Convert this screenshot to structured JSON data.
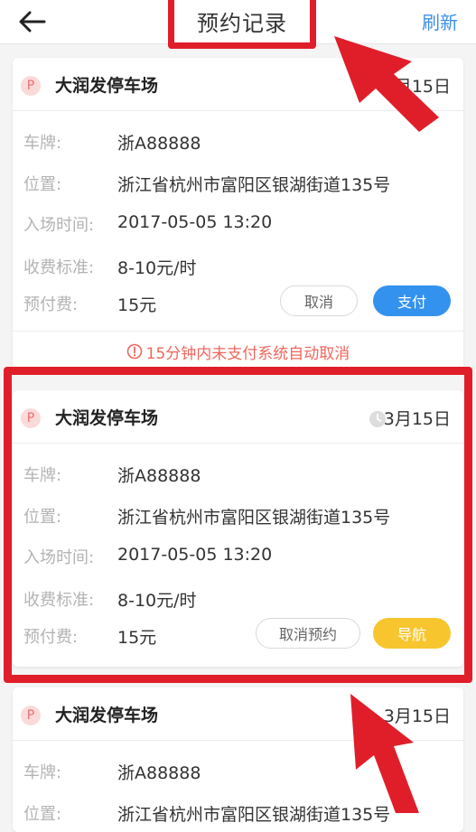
{
  "header": {
    "title": "预约记录",
    "refresh_label": "刷新"
  },
  "labels": {
    "plate": "车牌:",
    "location": "位置:",
    "entry_time": "入场时间:",
    "fee_standard": "收费标准:",
    "prepaid": "预付费:"
  },
  "cards": [
    {
      "badge": "P",
      "lot_name": "大润发停车场",
      "date": "3月15日",
      "plate": "浙A88888",
      "location": "浙江省杭州市富阳区银湖街道135号",
      "entry_time": "2017-05-05 13:20",
      "fee_standard": "8-10元/时",
      "prepaid": "15元",
      "button_secondary": "取消",
      "button_primary": "支付",
      "notice": "15分钟内未支付系统自动取消"
    },
    {
      "badge": "P",
      "lot_name": "大润发停车场",
      "date": "3月15日",
      "plate": "浙A88888",
      "location": "浙江省杭州市富阳区银湖街道135号",
      "entry_time": "2017-05-05 13:20",
      "fee_standard": "8-10元/时",
      "prepaid": "15元",
      "button_secondary": "取消预约",
      "button_primary": "导航"
    },
    {
      "badge": "P",
      "lot_name": "大润发停车场",
      "date": "3月15日",
      "plate": "浙A88888",
      "location": "浙江省杭州市富阳区银湖街道135号"
    }
  ],
  "icons": {
    "back": "back-arrow-icon",
    "clock": "clock-icon",
    "warning": "warning-circle-icon"
  },
  "colors": {
    "accent_blue": "#3492ef",
    "accent_yellow": "#f7c52e",
    "annotation_red": "#e01e2a",
    "notice_red": "#f0675d"
  }
}
